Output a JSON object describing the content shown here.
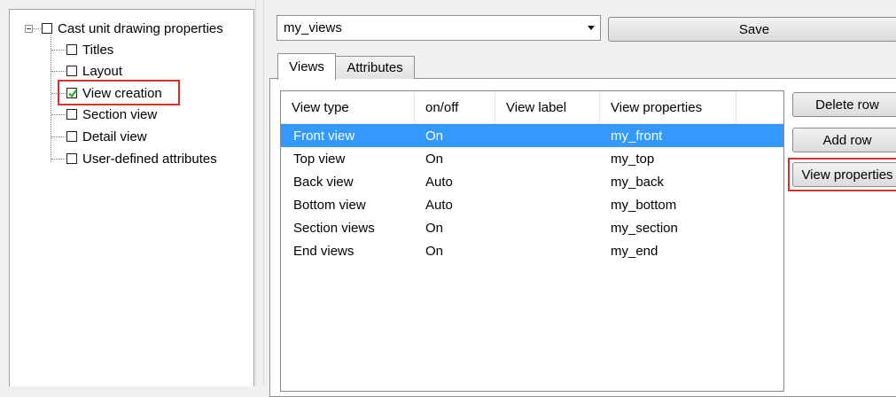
{
  "tree": {
    "root": {
      "label": "Cast unit drawing properties",
      "checked": false
    },
    "children": [
      {
        "label": "Titles",
        "checked": false
      },
      {
        "label": "Layout",
        "checked": false
      },
      {
        "label": "View creation",
        "checked": true,
        "highlighted": true
      },
      {
        "label": "Section view",
        "checked": false
      },
      {
        "label": "Detail view",
        "checked": false
      },
      {
        "label": "User-defined attributes",
        "checked": false
      }
    ]
  },
  "toolbar": {
    "combo_value": "my_views",
    "save_label": "Save"
  },
  "tabs": [
    {
      "label": "Views",
      "active": true
    },
    {
      "label": "Attributes",
      "active": false
    }
  ],
  "table": {
    "columns": [
      "View type",
      "on/off",
      "View label",
      "View properties"
    ],
    "rows": [
      {
        "view_type": "Front view",
        "on_off": "On",
        "view_label": "",
        "view_properties": "my_front",
        "selected": true
      },
      {
        "view_type": "Top view",
        "on_off": "On",
        "view_label": "",
        "view_properties": "my_top",
        "selected": false
      },
      {
        "view_type": "Back view",
        "on_off": "Auto",
        "view_label": "",
        "view_properties": "my_back",
        "selected": false
      },
      {
        "view_type": "Bottom view",
        "on_off": "Auto",
        "view_label": "",
        "view_properties": "my_bottom",
        "selected": false
      },
      {
        "view_type": "Section views",
        "on_off": "On",
        "view_label": "",
        "view_properties": "my_section",
        "selected": false
      },
      {
        "view_type": "End views",
        "on_off": "On",
        "view_label": "",
        "view_properties": "my_end",
        "selected": false
      }
    ]
  },
  "buttons": {
    "delete_row": "Delete row",
    "add_row": "Add row",
    "view_properties": "View properties"
  },
  "colors": {
    "selection": "#3399ff",
    "highlight_frame": "#d9302a",
    "checkmark": "#2bb32b"
  }
}
